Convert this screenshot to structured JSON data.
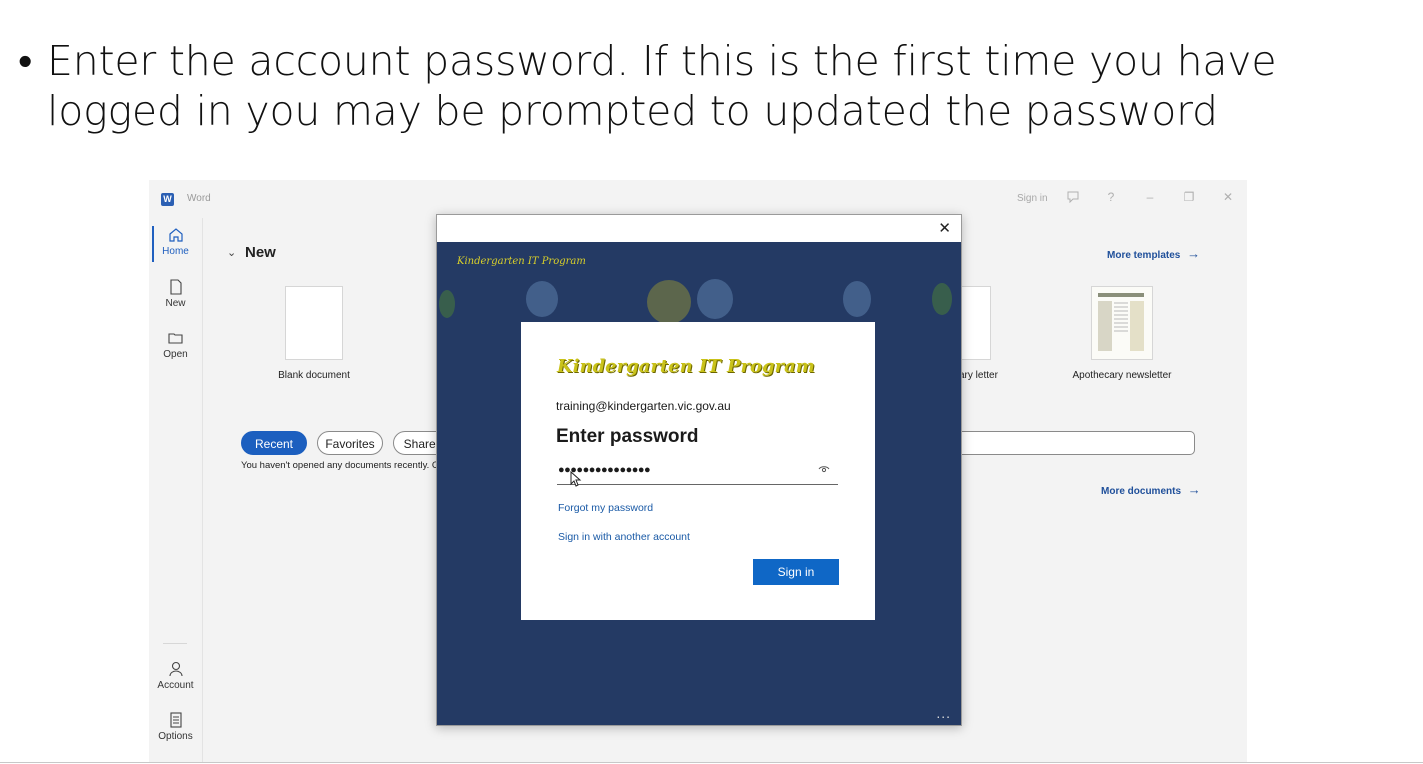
{
  "slide": {
    "bullet": "•",
    "text": "Enter the account password. If this is the first time you have logged in you may be prompted to updated the password"
  },
  "word": {
    "title": "Word",
    "titlebar": {
      "signin": "Sign in",
      "icons": [
        "feedback-icon",
        "help-icon",
        "minimize-icon",
        "restore-icon",
        "close-icon"
      ],
      "help_label": "?",
      "minimize_label": "–",
      "restore_label": "❐",
      "close_label": "✕"
    },
    "rail": {
      "home": "Home",
      "new": "New",
      "open": "Open",
      "account": "Account",
      "options": "Options"
    },
    "new_section": {
      "chevron": "⌄",
      "heading": "New",
      "more_templates": "More templates",
      "arrow": "→",
      "blank_label": "Blank document",
      "tpl_label1": "ary letter",
      "tpl_label2": "Apothecary newsletter"
    },
    "filters": {
      "recent": "Recent",
      "favorites": "Favorites",
      "shared": "Shared"
    },
    "recent_message": "You haven't opened any documents recently. C",
    "more_documents": "More documents",
    "arrow": "→"
  },
  "dialog": {
    "close": "✕",
    "banner_title": "Kindergarten IT Program",
    "more": "...",
    "card": {
      "logo": "Kindergarten IT Program",
      "email": "training@kindergarten.vic.gov.au",
      "heading": "Enter password",
      "password_mask": "●●●●●●●●●●●●●●●",
      "forgot": "Forgot my password",
      "another": "Sign in with another account",
      "signin": "Sign in"
    }
  },
  "colors": {
    "accent": "#1c5fbf",
    "dialog_bg": "#243a64",
    "logo_yellow": "#c9c21a",
    "link": "#1a5aa6"
  }
}
